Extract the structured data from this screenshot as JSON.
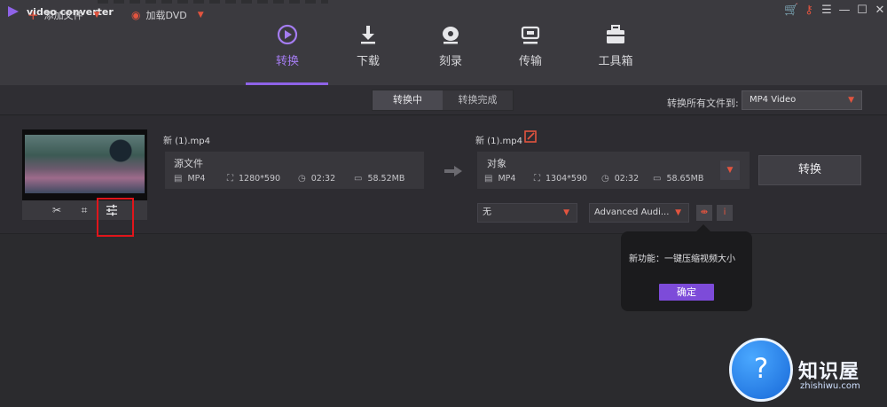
{
  "app": {
    "title": "video converter"
  },
  "colors": {
    "accent": "#8f63e8",
    "danger": "#e2543f",
    "highlight_box": "#e0151b"
  },
  "window_controls": [
    {
      "icon": "cart-icon"
    },
    {
      "icon": "key-icon"
    },
    {
      "icon": "menu-icon"
    },
    {
      "icon": "minimize-icon"
    },
    {
      "icon": "close-icon"
    }
  ],
  "nav": {
    "tabs": [
      {
        "label": "转换",
        "icon": "convert-icon",
        "active": true
      },
      {
        "label": "下载",
        "icon": "download-icon",
        "active": false
      },
      {
        "label": "刻录",
        "icon": "burn-icon",
        "active": false
      },
      {
        "label": "传输",
        "icon": "transfer-icon",
        "active": false
      },
      {
        "label": "工具箱",
        "icon": "toolbox-icon",
        "active": false
      }
    ]
  },
  "toolbar": {
    "add_file": "添加文件",
    "load_dvd": "加载DVD",
    "segments": [
      {
        "label": "转换中",
        "active": true
      },
      {
        "label": "转换完成",
        "active": false
      }
    ],
    "convert_all_label": "转换所有文件到:",
    "format_value": "MP4 Video"
  },
  "task": {
    "source": {
      "filename": "新 (1).mp4",
      "panel_title": "源文件",
      "format": "MP4",
      "resolution": "1280*590",
      "duration": "02:32",
      "size": "58.52MB"
    },
    "target": {
      "filename": "新 (1).mp4",
      "panel_title": "对象",
      "format": "MP4",
      "resolution": "1304*590",
      "duration": "02:32",
      "size": "58.65MB"
    },
    "subtitle_value": "无",
    "audio_value": "Advanced Audi...",
    "convert_button": "转换"
  },
  "popup": {
    "text": "新功能：一键压缩视频大小",
    "ok_label": "确定"
  },
  "watermark": {
    "text": "知识屋",
    "sub": "zhishiwu.com"
  }
}
